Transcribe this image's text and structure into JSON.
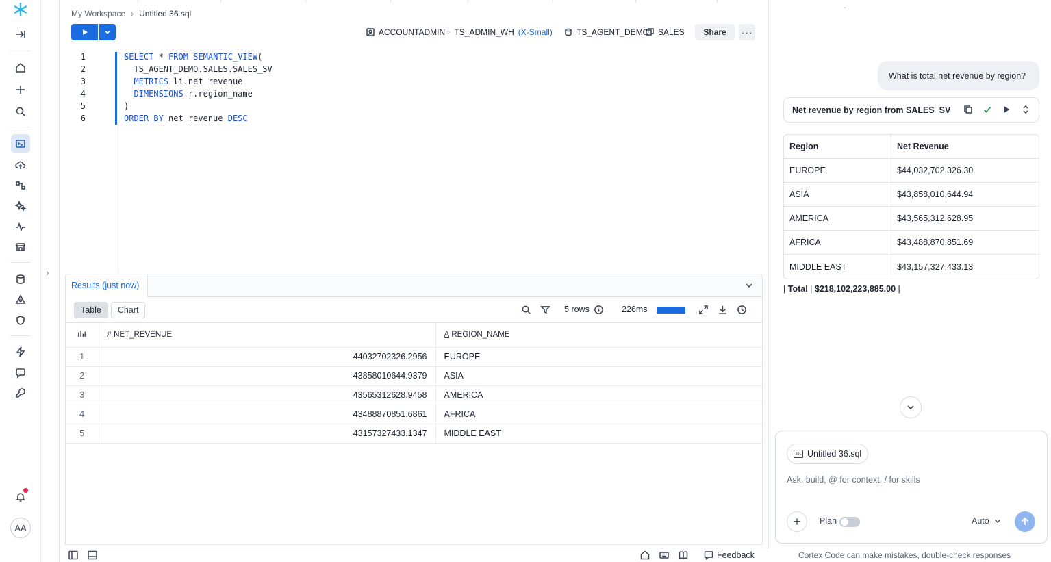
{
  "breadcrumb": {
    "workspace": "My Workspace",
    "file": "Untitled 36.sql"
  },
  "context": {
    "role": "ACCOUNTADMIN",
    "warehouse": "TS_ADMIN_WH",
    "warehouse_size": "(X-Small)",
    "database": "TS_AGENT_DEMO",
    "schema": "SALES"
  },
  "toolbar": {
    "share_label": "Share"
  },
  "editor": {
    "lines": [
      {
        "n": "1",
        "kw1": "SELECT",
        "t1": " * ",
        "kw2": "FROM",
        "t2": " ",
        "kw3": "SEMANTIC_VIEW",
        "t3": "("
      },
      {
        "n": "2",
        "kw1": "",
        "t1": "  TS_AGENT_DEMO.SALES.SALES_SV",
        "kw2": "",
        "t2": "",
        "kw3": "",
        "t3": ""
      },
      {
        "n": "3",
        "kw1": "  METRICS",
        "t1": " li.net_revenue",
        "kw2": "",
        "t2": "",
        "kw3": "",
        "t3": ""
      },
      {
        "n": "4",
        "kw1": "  DIMENSIONS",
        "t1": " r.region_name",
        "kw2": "",
        "t2": "",
        "kw3": "",
        "t3": ""
      },
      {
        "n": "5",
        "kw1": "",
        "t1": ")",
        "kw2": "",
        "t2": "",
        "kw3": "",
        "t3": ""
      },
      {
        "n": "6",
        "kw1": "ORDER BY",
        "t1": " net_revenue ",
        "kw2": "DESC",
        "t2": "",
        "kw3": "",
        "t3": ""
      }
    ]
  },
  "results": {
    "tab_label": "Results",
    "tab_time": "(just now)",
    "view_table": "Table",
    "view_chart": "Chart",
    "rows_label": "5 rows",
    "duration": "226ms",
    "columns": [
      "NET_REVENUE",
      "REGION_NAME"
    ],
    "rows": [
      {
        "idx": "1",
        "net_revenue": "44032702326.2956",
        "region": "EUROPE"
      },
      {
        "idx": "2",
        "net_revenue": "43858010644.9379",
        "region": "ASIA"
      },
      {
        "idx": "3",
        "net_revenue": "43565312628.9458",
        "region": "AMERICA"
      },
      {
        "idx": "4",
        "net_revenue": "43488870851.6861",
        "region": "AFRICA"
      },
      {
        "idx": "5",
        "net_revenue": "43157327433.1347",
        "region": "MIDDLE EAST"
      }
    ]
  },
  "footer": {
    "feedback_label": "Feedback"
  },
  "user": {
    "initials": "AA"
  },
  "chat": {
    "top_mark": "-",
    "user_message": "What is total net revenue by region?",
    "card_title": "Net revenue by region from SALES_SV",
    "table_headers": [
      "Region",
      "Net Revenue"
    ],
    "table_rows": [
      {
        "region": "EUROPE",
        "revenue": "$44,032,702,326.30"
      },
      {
        "region": "ASIA",
        "revenue": "$43,858,010,644.94"
      },
      {
        "region": "AMERICA",
        "revenue": "$43,565,312,628.95"
      },
      {
        "region": "AFRICA",
        "revenue": "$43,488,870,851.69"
      },
      {
        "region": "MIDDLE EAST",
        "revenue": "$43,157,327,433.13"
      }
    ],
    "total_pipe1": "| ",
    "total_label": "Total",
    "total_pipe2": " | ",
    "total_value": "$218,102,223,885.00",
    "total_pipe3": " |",
    "context_chip": "Untitled 36.sql",
    "placeholder": "Ask, build, @ for context, / for skills",
    "plan_label": "Plan",
    "model_label": "Auto",
    "disclaimer": "Cortex Code can make mistakes, double-check responses"
  },
  "colors": {
    "accent": "#1a6ce0",
    "active_nav_bg": "#dde7f5",
    "notification": "#e0264a"
  }
}
